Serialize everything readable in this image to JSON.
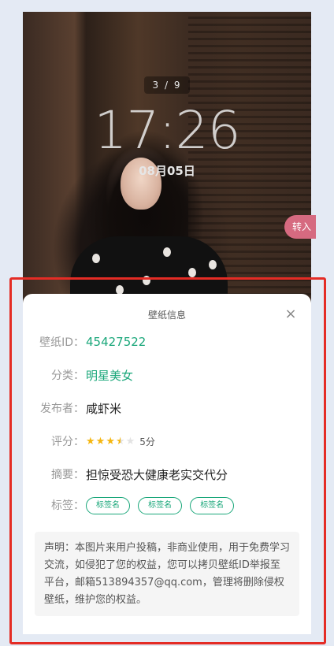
{
  "lockscreen": {
    "pager": "3 / 9",
    "time": "17:26",
    "date": "08月05日",
    "side_button": "转入"
  },
  "sheet": {
    "title": "壁纸信息",
    "close": "×",
    "rows": {
      "id": {
        "label": "壁纸ID：",
        "value": "45427522"
      },
      "category": {
        "label": "分类：",
        "value": "明星美女"
      },
      "publisher": {
        "label": "发布者：",
        "value": "咸虾米"
      },
      "rating": {
        "label": "评分：",
        "value": "5分",
        "stars": 3.5,
        "max": 5
      },
      "summary": {
        "label": "摘要：",
        "value": "担惊受恐大健康老实交代分"
      },
      "tags": {
        "label": "标签：",
        "items": [
          "标签名",
          "标签名",
          "标签名"
        ]
      }
    },
    "notice": "声明：本图片来用户投稿，非商业使用，用于免费学习交流，如侵犯了您的权益，您可以拷贝壁纸ID举报至平台，邮箱513894357@qq.com，管理将删除侵权壁纸，维护您的权益。"
  },
  "colors": {
    "accent": "#1aa77a",
    "star": "#f5b60f",
    "highlight_border": "#e42c25"
  }
}
